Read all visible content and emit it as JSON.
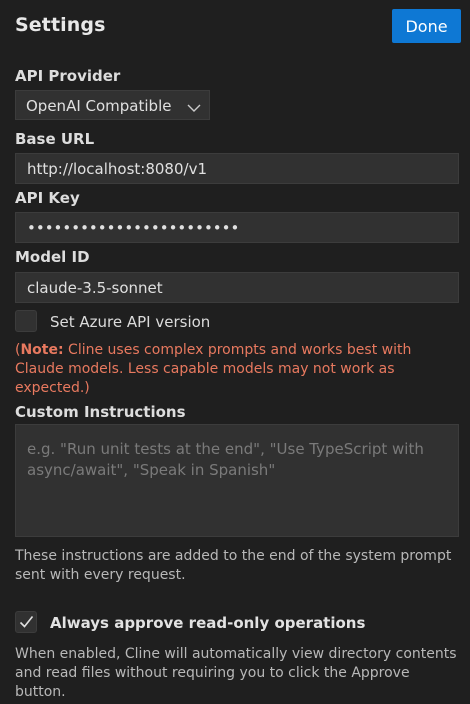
{
  "header": {
    "title": "Settings",
    "done_label": "Done"
  },
  "api_provider": {
    "label": "API Provider",
    "selected": "OpenAI Compatible"
  },
  "base_url": {
    "label": "Base URL",
    "value": "http://localhost:8080/v1"
  },
  "api_key": {
    "label": "API Key",
    "value": "••••••••••••••••••••••••"
  },
  "model_id": {
    "label": "Model ID",
    "value": "claude-3.5-sonnet"
  },
  "azure": {
    "label": "Set Azure API version",
    "checked": false
  },
  "note": {
    "open": "(",
    "prefix": "Note:",
    "text": " Cline uses complex prompts and works best with Claude models. Less capable models may not work as expected.)"
  },
  "custom_instructions": {
    "label": "Custom Instructions",
    "placeholder": "e.g. \"Run unit tests at the end\", \"Use TypeScript with async/await\", \"Speak in Spanish\"",
    "help": "These instructions are added to the end of the system prompt sent with every request."
  },
  "always_approve": {
    "label": "Always approve read-only operations",
    "checked": true,
    "help": "When enabled, Cline will automatically view directory contents and read files without requiring you to click the Approve button."
  },
  "colors": {
    "background": "#1f1f1f",
    "accent": "#0e78d4",
    "note": "#e8795f",
    "input_bg": "#313131"
  },
  "icons": {
    "dropdown": "chevron-down-icon",
    "check": "checkmark-icon"
  }
}
